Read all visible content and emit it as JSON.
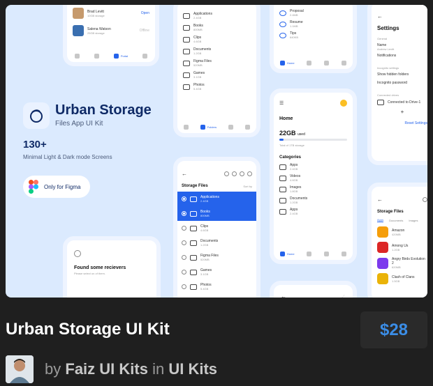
{
  "hero": {
    "brand_title": "Urban Storage",
    "brand_subtitle": "Files App UI Kit",
    "screen_count": "130+",
    "screen_desc": "Minimal Light & Dark mode Screens",
    "figma_label": "Only for Figma"
  },
  "shared_users": {
    "user1_name": "Brad Levitt",
    "user1_size": "10GB storage",
    "user1_action": "Open",
    "user2_name": "Salena Watson",
    "user2_size": "25GB storage",
    "user2_action": "Offline",
    "nav_portal": "Portal"
  },
  "folders_screen": {
    "folders": [
      {
        "name": "Applications",
        "size": "2.4GB"
      },
      {
        "name": "Books",
        "size": "800MB"
      },
      {
        "name": "Clips",
        "size": "4.6GB"
      },
      {
        "name": "Documents",
        "size": "1.2GB"
      },
      {
        "name": "Figma Files",
        "size": "520MB"
      },
      {
        "name": "Games",
        "size": "3.1GB"
      },
      {
        "name": "Photos",
        "size": "5.4GB"
      }
    ],
    "nav_folders": "Folders"
  },
  "storage_screen": {
    "title": "Storage Files",
    "sort": "Sort by",
    "folders": [
      {
        "name": "Applications",
        "size": "2.4GB"
      },
      {
        "name": "Books",
        "size": "800MB"
      },
      {
        "name": "Clips",
        "size": "4.6GB"
      },
      {
        "name": "Documents",
        "size": "1.2GB"
      },
      {
        "name": "Figma Files",
        "size": "520MB"
      },
      {
        "name": "Games",
        "size": "3.1GB"
      },
      {
        "name": "Photos",
        "size": "5.4GB"
      }
    ]
  },
  "proposal_screen": {
    "items": [
      {
        "name": "Proposal",
        "size": "2.4MB"
      },
      {
        "name": "Resume",
        "size": "1.1MB"
      },
      {
        "name": "Tips",
        "size": "640KB"
      }
    ],
    "nav_home": "Home"
  },
  "home_screen": {
    "title": "Home",
    "used": "22GB",
    "used_suffix": "used",
    "total": "Total of 1TB storage",
    "categories_title": "Categories",
    "categories": [
      {
        "name": "Apps",
        "size": "2.4GB"
      },
      {
        "name": "Videos",
        "size": "4.6GB"
      },
      {
        "name": "Images",
        "size": "1.8GB"
      },
      {
        "name": "Documents",
        "size": "1.2GB"
      },
      {
        "name": "Apps",
        "size": "2.4GB"
      }
    ],
    "nav_home": "Home"
  },
  "settings_screen": {
    "title": "Settings",
    "general": "General",
    "name_label": "Name",
    "name_value": "Andrew Levitt",
    "notifications": "Notifications",
    "incognito_header": "Incognito settings",
    "show_hidden": "Show hidden folders",
    "incognito_password": "Incognito password",
    "connected_header": "Connected drives",
    "connected_drive": "Connected to Drive-1",
    "reset": "Reset Settings"
  },
  "storage_files2": {
    "title": "Storage Files",
    "tabs": [
      "Apps",
      "Documents",
      "Images"
    ],
    "apps": [
      {
        "name": "Amazon",
        "size": "420MB"
      },
      {
        "name": "Among Us",
        "size": "1.2GB"
      },
      {
        "name": "Angry Birds Evolution 2",
        "size": "620MB"
      },
      {
        "name": "Clash of Clans",
        "size": "1.5GB"
      }
    ]
  },
  "receivers_screen": {
    "title": "Found some recievers",
    "subtitle": "Please select on of them."
  },
  "product": {
    "title": "Urban Storage UI Kit",
    "price": "$28",
    "by": "by",
    "author": "Faiz UI Kits",
    "in": "in",
    "category": "UI Kits"
  },
  "colors": {
    "accent": "#2563eb",
    "hero_bg": "#dbeafe",
    "price": "#3b8de6",
    "page_bg": "#1f1f1f"
  }
}
